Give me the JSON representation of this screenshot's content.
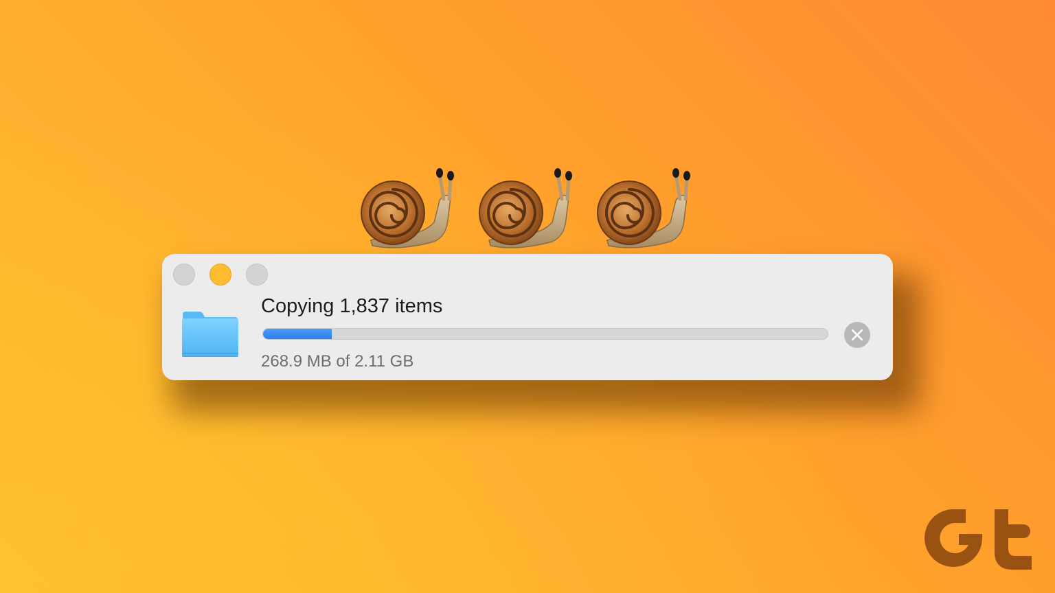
{
  "background": {
    "colors": [
      "#ffbf2e",
      "#ff8a33"
    ]
  },
  "decorations": {
    "snails": [
      {
        "icon": "snail-emoji"
      },
      {
        "icon": "snail-emoji"
      },
      {
        "icon": "snail-emoji"
      }
    ]
  },
  "dialog": {
    "window_controls": {
      "close_color": "#d3d3d3",
      "minimize_color": "#febc2e",
      "zoom_color": "#d3d3d3"
    },
    "icon": "folder-icon",
    "title": "Copying 1,837 items",
    "progress": {
      "fraction": 0.122,
      "accent": "#2a7fec"
    },
    "status": "268.9 MB of 2.11 GB",
    "cancel_icon": "close-circle-icon"
  },
  "brand": {
    "logo": "guiding-tech-logo",
    "color": "#9a5212"
  }
}
